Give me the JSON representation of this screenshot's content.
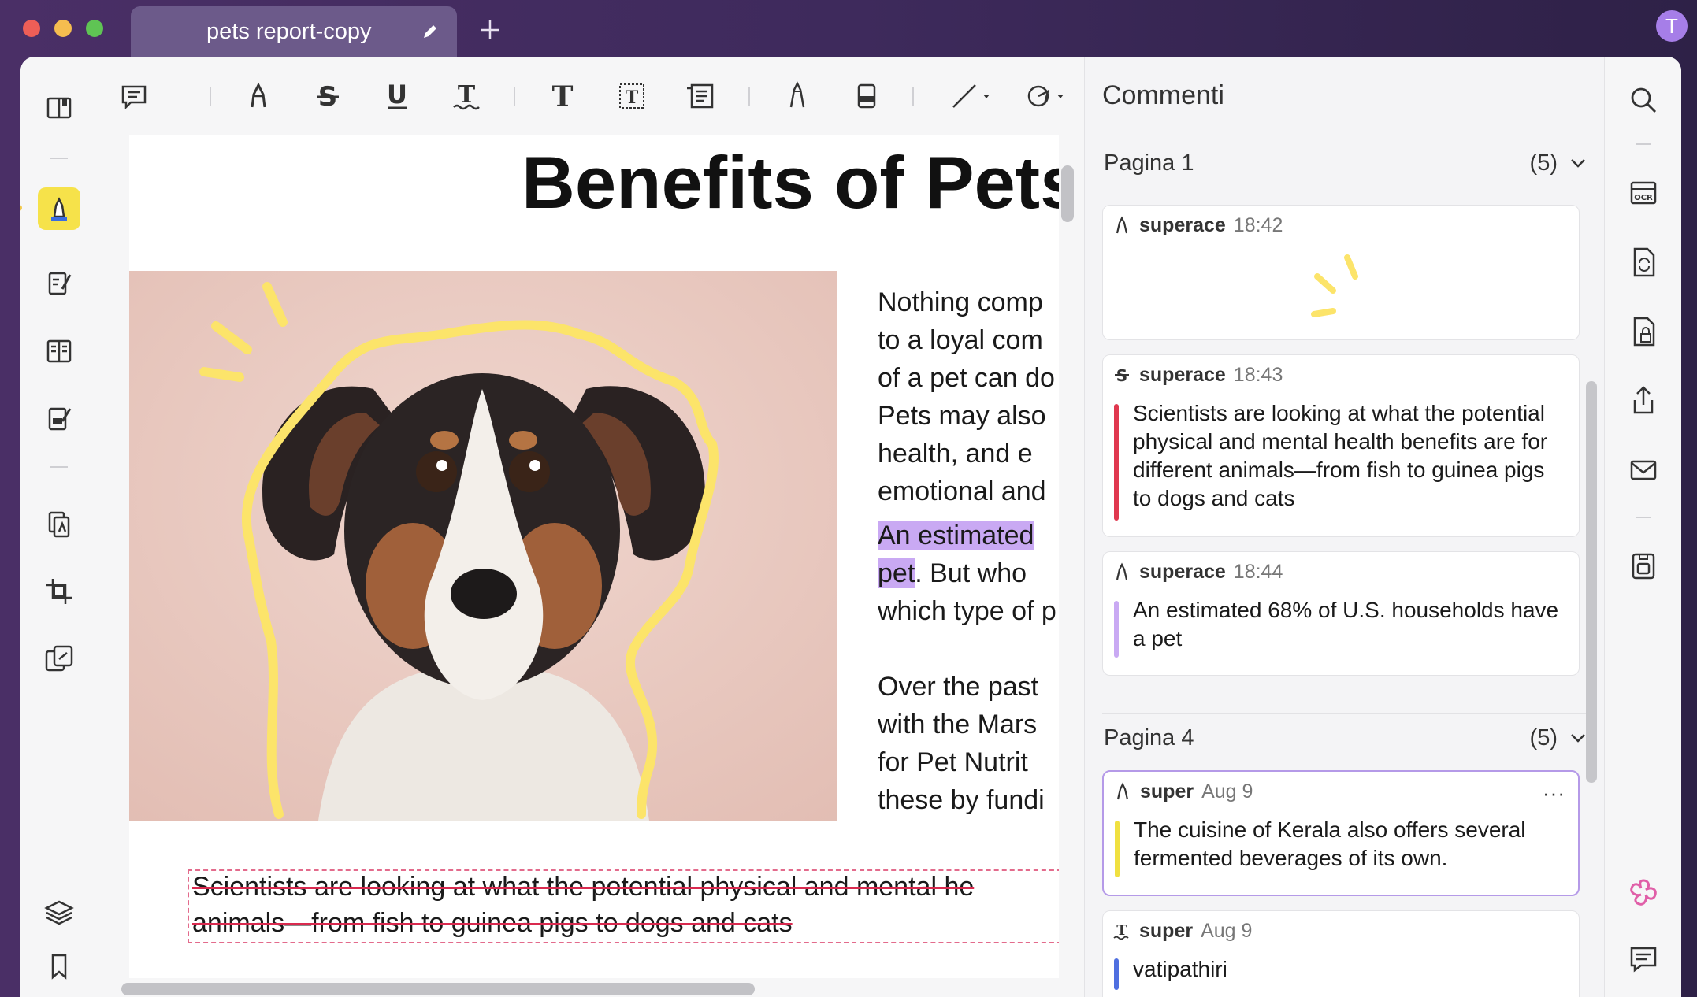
{
  "window": {
    "tab_title": "pets report-copy",
    "avatar_initial": "T"
  },
  "document": {
    "title": "Benefits of Pets",
    "paragraph1": [
      "Nothing comp",
      "to a loyal com",
      "of a pet can do",
      "Pets may also",
      "health, and e",
      "emotional and"
    ],
    "paragraph2_line1": "An estimated",
    "paragraph2_line2_hl": "pet",
    "paragraph2_line2_rest": ". But who",
    "paragraph2_line3": "which type of p",
    "paragraph3": [
      "Over the past",
      "with the Mars",
      "for Pet Nutrit",
      "these by fundi"
    ],
    "strike_line1": "Scientists are looking at what the potential physical and mental he",
    "strike_line2": "animals—from fish to guinea pigs to dogs and cats"
  },
  "comments": {
    "title": "Commenti",
    "sections": [
      {
        "label": "Pagina 1",
        "count": "(5)",
        "items": [
          {
            "user": "superace",
            "time": "18:42",
            "text": "",
            "type": "pencil"
          },
          {
            "user": "superace",
            "time": "18:43",
            "text": "Scientists are looking at what the potential physical and mental health benefits are for different animals—from fish to guinea pigs to dogs and cats",
            "type": "strikethrough",
            "color": "#e0384f"
          },
          {
            "user": "superace",
            "time": "18:44",
            "text": "An estimated 68% of U.S. households have a pet",
            "type": "highlight",
            "color": "#c9a9f3"
          }
        ]
      },
      {
        "label": "Pagina 4",
        "count": "(5)",
        "items": [
          {
            "user": "super",
            "time": "Aug 9",
            "text": "The cuisine of Kerala also offers several fermented beverages of its own.",
            "type": "highlight",
            "color": "#f0e040"
          },
          {
            "user": "super",
            "time": "Aug 9",
            "text": "vatipathiri",
            "type": "underline-text",
            "color": "#4f6fe0"
          }
        ]
      }
    ],
    "more_label": "···"
  },
  "colors": {
    "accent_yellow": "#f6e24a",
    "highlight_purple": "#c9a9f3",
    "strike_red": "#e0384f"
  }
}
